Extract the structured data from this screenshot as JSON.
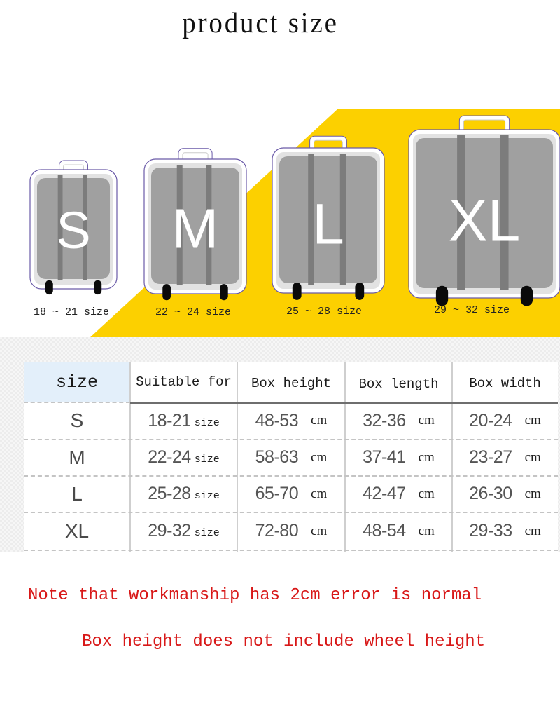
{
  "title": "product size",
  "colors": {
    "banner_yellow": "#fcd000",
    "note_red": "#d81818",
    "suitcase_body": "#a0a0a0",
    "suitcase_stripe": "#7c7c7c",
    "header_highlight": "#e3effa"
  },
  "suitcases": [
    {
      "letter": "S",
      "range_label": "18 ~ 21 size"
    },
    {
      "letter": "M",
      "range_label": "22 ~ 24 size"
    },
    {
      "letter": "L",
      "range_label": "25 ~ 28 size"
    },
    {
      "letter": "XL",
      "range_label": "29 ~ 32 size"
    }
  ],
  "table": {
    "headers": [
      "size",
      "Suitable for",
      "Box height",
      "Box length",
      "Box width"
    ],
    "rows": [
      {
        "size": "S",
        "suitable": "18-21",
        "suitable_unit": "size",
        "height": "48-53",
        "length": "32-36",
        "width": "20-24",
        "unit": "cm"
      },
      {
        "size": "M",
        "suitable": "22-24",
        "suitable_unit": "size",
        "height": "58-63",
        "length": "37-41",
        "width": "23-27",
        "unit": "cm"
      },
      {
        "size": "L",
        "suitable": "25-28",
        "suitable_unit": "size",
        "height": "65-70",
        "length": "42-47",
        "width": "26-30",
        "unit": "cm"
      },
      {
        "size": "XL",
        "suitable": "29-32",
        "suitable_unit": "size",
        "height": "72-80",
        "length": "48-54",
        "width": "29-33",
        "unit": "cm"
      }
    ]
  },
  "notes": [
    "Note that workmanship has 2cm error is normal",
    "Box height does not include wheel height"
  ]
}
